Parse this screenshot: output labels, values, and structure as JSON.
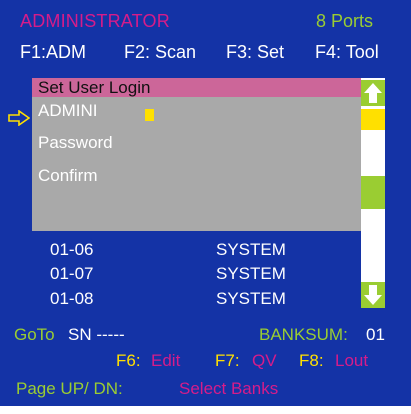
{
  "header": {
    "title": "ADMINISTRATOR",
    "ports": "8 Ports"
  },
  "function_keys": [
    {
      "key": "F1:",
      "label": "ADM"
    },
    {
      "key": "F2:",
      "label": "Scan"
    },
    {
      "key": "F3:",
      "label": "Set"
    },
    {
      "key": "F4:",
      "label": "Tool"
    }
  ],
  "dialog": {
    "title": "Set User Login",
    "username_value": "ADMINI",
    "password_label": "Password",
    "confirm_label": "Confirm"
  },
  "ports_list": [
    {
      "port": "01-06",
      "name": "SYSTEM"
    },
    {
      "port": "01-07",
      "name": "SYSTEM"
    },
    {
      "port": "01-08",
      "name": "SYSTEM"
    }
  ],
  "status": {
    "goto_label": "GoTo",
    "sn_label": "SN -----",
    "banksum_label": "BANKSUM:",
    "banksum_value": "01"
  },
  "shortcuts": [
    {
      "key": "F6:",
      "action": "Edit"
    },
    {
      "key": "F7:",
      "action": "QV"
    },
    {
      "key": "F8:",
      "action": "Lout"
    }
  ],
  "footer": {
    "label": "Page UP/ DN:",
    "action": "Select Banks"
  },
  "colors": {
    "background": "#1433a6",
    "magenta": "#d61c8a",
    "green": "#9acd32",
    "yellow": "#ffe000",
    "dialog_gray": "#a9a9a9",
    "dialog_title": "#cc6699"
  },
  "icons": {
    "pointer": "right-arrow-outline-icon",
    "scroll_up": "up-arrow-icon",
    "scroll_down": "down-arrow-icon"
  }
}
